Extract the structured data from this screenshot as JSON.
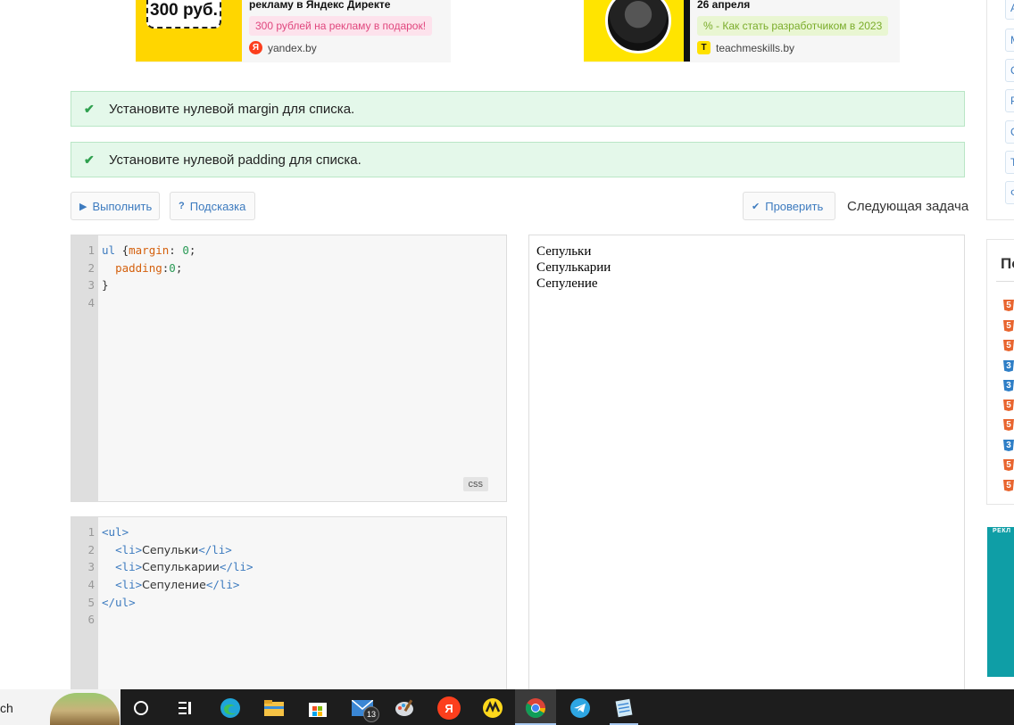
{
  "ads": [
    {
      "price": "300 руб.",
      "title": "рекламу в Яндекс Директе",
      "badge": "300 рублей на рекламу в подарок!",
      "source_icon": "Я",
      "source": "yandex.by",
      "badge_color": "#e0477e"
    },
    {
      "title": "26 апреля",
      "badge": "% - Как стать разработчиком в 2023",
      "source_icon": "T",
      "source": "teachmeskills.by",
      "badge_color": "#7aac2a"
    }
  ],
  "messages": [
    {
      "icon": "check-icon",
      "text": "Установите нулевой margin для списка."
    },
    {
      "icon": "check-icon",
      "text": "Установите нулевой padding для списка."
    }
  ],
  "toolbar": {
    "run_label": "Выполнить",
    "hint_label": "Подсказка",
    "check_label": "Проверить",
    "next_label": "Следующая задача"
  },
  "css_editor": {
    "lang": "css",
    "line_numbers": [
      "1",
      "2",
      "3",
      "4"
    ]
  },
  "html_editor": {
    "line_numbers": [
      "1",
      "2",
      "3",
      "4",
      "5",
      "6"
    ]
  },
  "result": {
    "items": [
      "Сепульки",
      "Сепулькарии",
      "Сепуление"
    ]
  },
  "sidebar": {
    "buttons": [
      "А",
      "М",
      "С",
      "Р",
      "С",
      "Т",
      "Ф"
    ],
    "section_title": "По",
    "icons": [
      "html5-icon",
      "html5-icon",
      "html5-icon",
      "css3-icon",
      "css3-icon",
      "html5-icon",
      "html5-icon",
      "css3-icon",
      "html5-icon",
      "html5-icon"
    ],
    "ad_label": "РЕКЛ"
  },
  "taskbar": {
    "search_text": "ch",
    "mail_badge": "13",
    "yandex_letter": "Я"
  },
  "colors": {
    "success_bg": "#e4f8ea",
    "success_check": "#2fa04f",
    "link_blue": "#3d7bbf",
    "taskbar": "#1d1d1d"
  }
}
